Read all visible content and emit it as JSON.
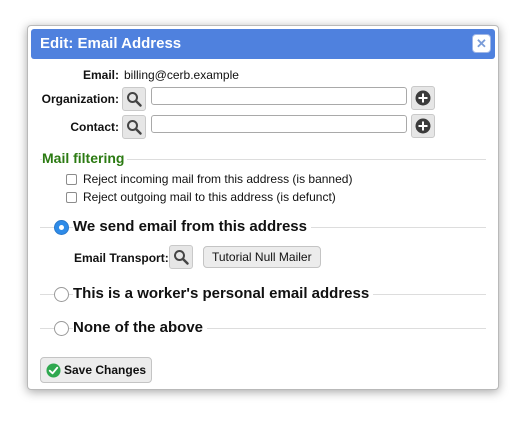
{
  "dialog": {
    "title": "Edit: Email Address",
    "close_icon": "close-icon"
  },
  "fields": {
    "email_label": "Email:",
    "email_value": "billing@cerb.example",
    "organization_label": "Organization:",
    "organization_value": "",
    "contact_label": "Contact:",
    "contact_value": ""
  },
  "mail_filtering": {
    "title": "Mail filtering",
    "options": [
      {
        "label": "Reject incoming mail from this address (is banned)",
        "checked": false
      },
      {
        "label": "Reject outgoing mail to this address (is defunct)",
        "checked": false
      }
    ]
  },
  "address_type": {
    "options": [
      {
        "label": "We send email from this address",
        "selected": true
      },
      {
        "label": "This is a worker's personal email address",
        "selected": false
      },
      {
        "label": "None of the above",
        "selected": false
      }
    ],
    "transport_label": "Email Transport:",
    "transport_value": "Tutorial Null Mailer"
  },
  "footer": {
    "save_label": "Save Changes"
  },
  "colors": {
    "titlebar": "#4f81de",
    "section_title": "#2b7a12",
    "radio_selected": "#2e8be8",
    "save_icon": "#2fa84f"
  }
}
